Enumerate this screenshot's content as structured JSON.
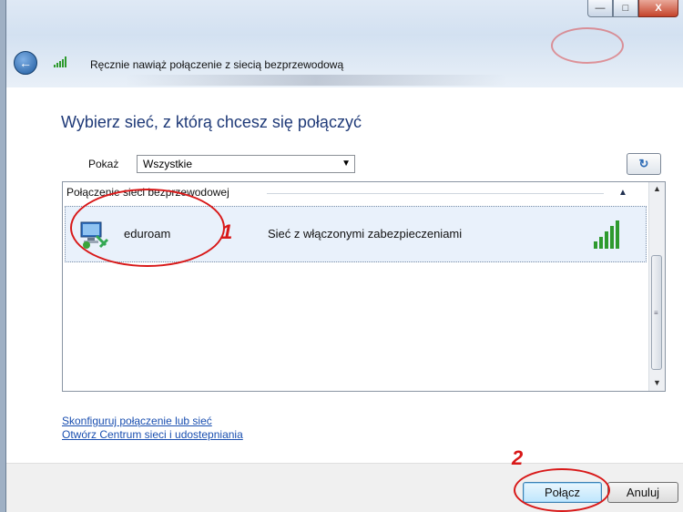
{
  "window": {
    "title": "Ręcznie nawiąż połączenie z siecią bezprzewodową",
    "controls": {
      "minimize": "—",
      "maximize": "□",
      "close": "X"
    }
  },
  "main": {
    "heading": "Wybierz sieć, z którą chcesz się połączyć",
    "show_label": "Pokaż",
    "show_value": "Wszystkie",
    "refresh_glyph": "↻"
  },
  "network_list": {
    "group_header": "Połączenie sieci bezprzewodowej",
    "networks": [
      {
        "ssid": "eduroam",
        "security": "Sieć z włączonymi zabezpieczeniami",
        "signal_bars": 5
      }
    ]
  },
  "links": {
    "configure": "Skonfiguruj połączenie lub sieć",
    "network_center": "Otwórz Centrum sieci i udostepniania"
  },
  "buttons": {
    "connect": "Połącz",
    "cancel": "Anuluj"
  },
  "annotations": {
    "step1": "1",
    "step2": "2",
    "color": "#d81818"
  },
  "icons": [
    "back-arrow-icon",
    "wireless-signal-icon",
    "refresh-icon",
    "network-computer-icon",
    "signal-strength-icon",
    "chevron-up-icon",
    "dropdown-arrow-icon"
  ]
}
